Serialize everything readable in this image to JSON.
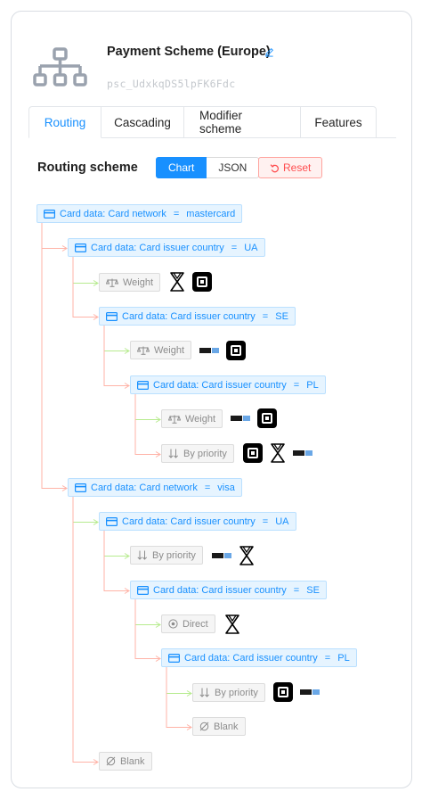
{
  "header": {
    "title": "Payment Scheme (Europe)",
    "scheme_id": "psc_UdxkqDS5lpFK6Fdc"
  },
  "tabs": [
    {
      "label": "Routing",
      "active": true
    },
    {
      "label": "Cascading",
      "active": false
    },
    {
      "label": "Modifier scheme",
      "active": false
    },
    {
      "label": "Features",
      "active": false
    }
  ],
  "routing": {
    "title": "Routing scheme",
    "view_toggle": {
      "chart": "Chart",
      "json": "JSON",
      "selected": "Chart"
    },
    "reset_label": "Reset"
  },
  "tree": {
    "n1": {
      "field": "Card data: Card network",
      "op": "=",
      "value": "mastercard"
    },
    "n2": {
      "field": "Card data: Card issuer country",
      "op": "=",
      "value": "UA"
    },
    "n3": {
      "label": "Weight",
      "providers": [
        "hourglass-logo",
        "square-logo"
      ]
    },
    "n4": {
      "field": "Card data: Card issuer country",
      "op": "=",
      "value": "SE"
    },
    "n5": {
      "label": "Weight",
      "providers": [
        "small-brand-logo",
        "square-logo"
      ]
    },
    "n6": {
      "field": "Card data: Card issuer country",
      "op": "=",
      "value": "PL"
    },
    "n7": {
      "label": "Weight",
      "providers": [
        "small-brand-logo",
        "square-logo"
      ]
    },
    "n8": {
      "label": "By priority",
      "providers": [
        "square-logo",
        "hourglass-logo",
        "small-brand-logo"
      ]
    },
    "n9": {
      "field": "Card data: Card network",
      "op": "=",
      "value": "visa"
    },
    "n10": {
      "field": "Card data: Card issuer country",
      "op": "=",
      "value": "UA"
    },
    "n11": {
      "label": "By priority",
      "providers": [
        "small-brand-logo",
        "hourglass-logo"
      ]
    },
    "n12": {
      "field": "Card data: Card issuer country",
      "op": "=",
      "value": "SE"
    },
    "n13": {
      "label": "Direct",
      "providers": [
        "hourglass-logo"
      ]
    },
    "n14": {
      "field": "Card data: Card issuer country",
      "op": "=",
      "value": "PL"
    },
    "n15": {
      "label": "By priority",
      "providers": [
        "square-logo",
        "small-brand-logo"
      ]
    },
    "n16": {
      "label": "Blank",
      "providers": []
    },
    "n17": {
      "label": "Blank",
      "providers": []
    }
  },
  "colors": {
    "accent": "#1890ff",
    "success_connector": "#b7eb8f",
    "failure_connector": "#ffb3a7",
    "reset_red": "#ff4d4f"
  }
}
